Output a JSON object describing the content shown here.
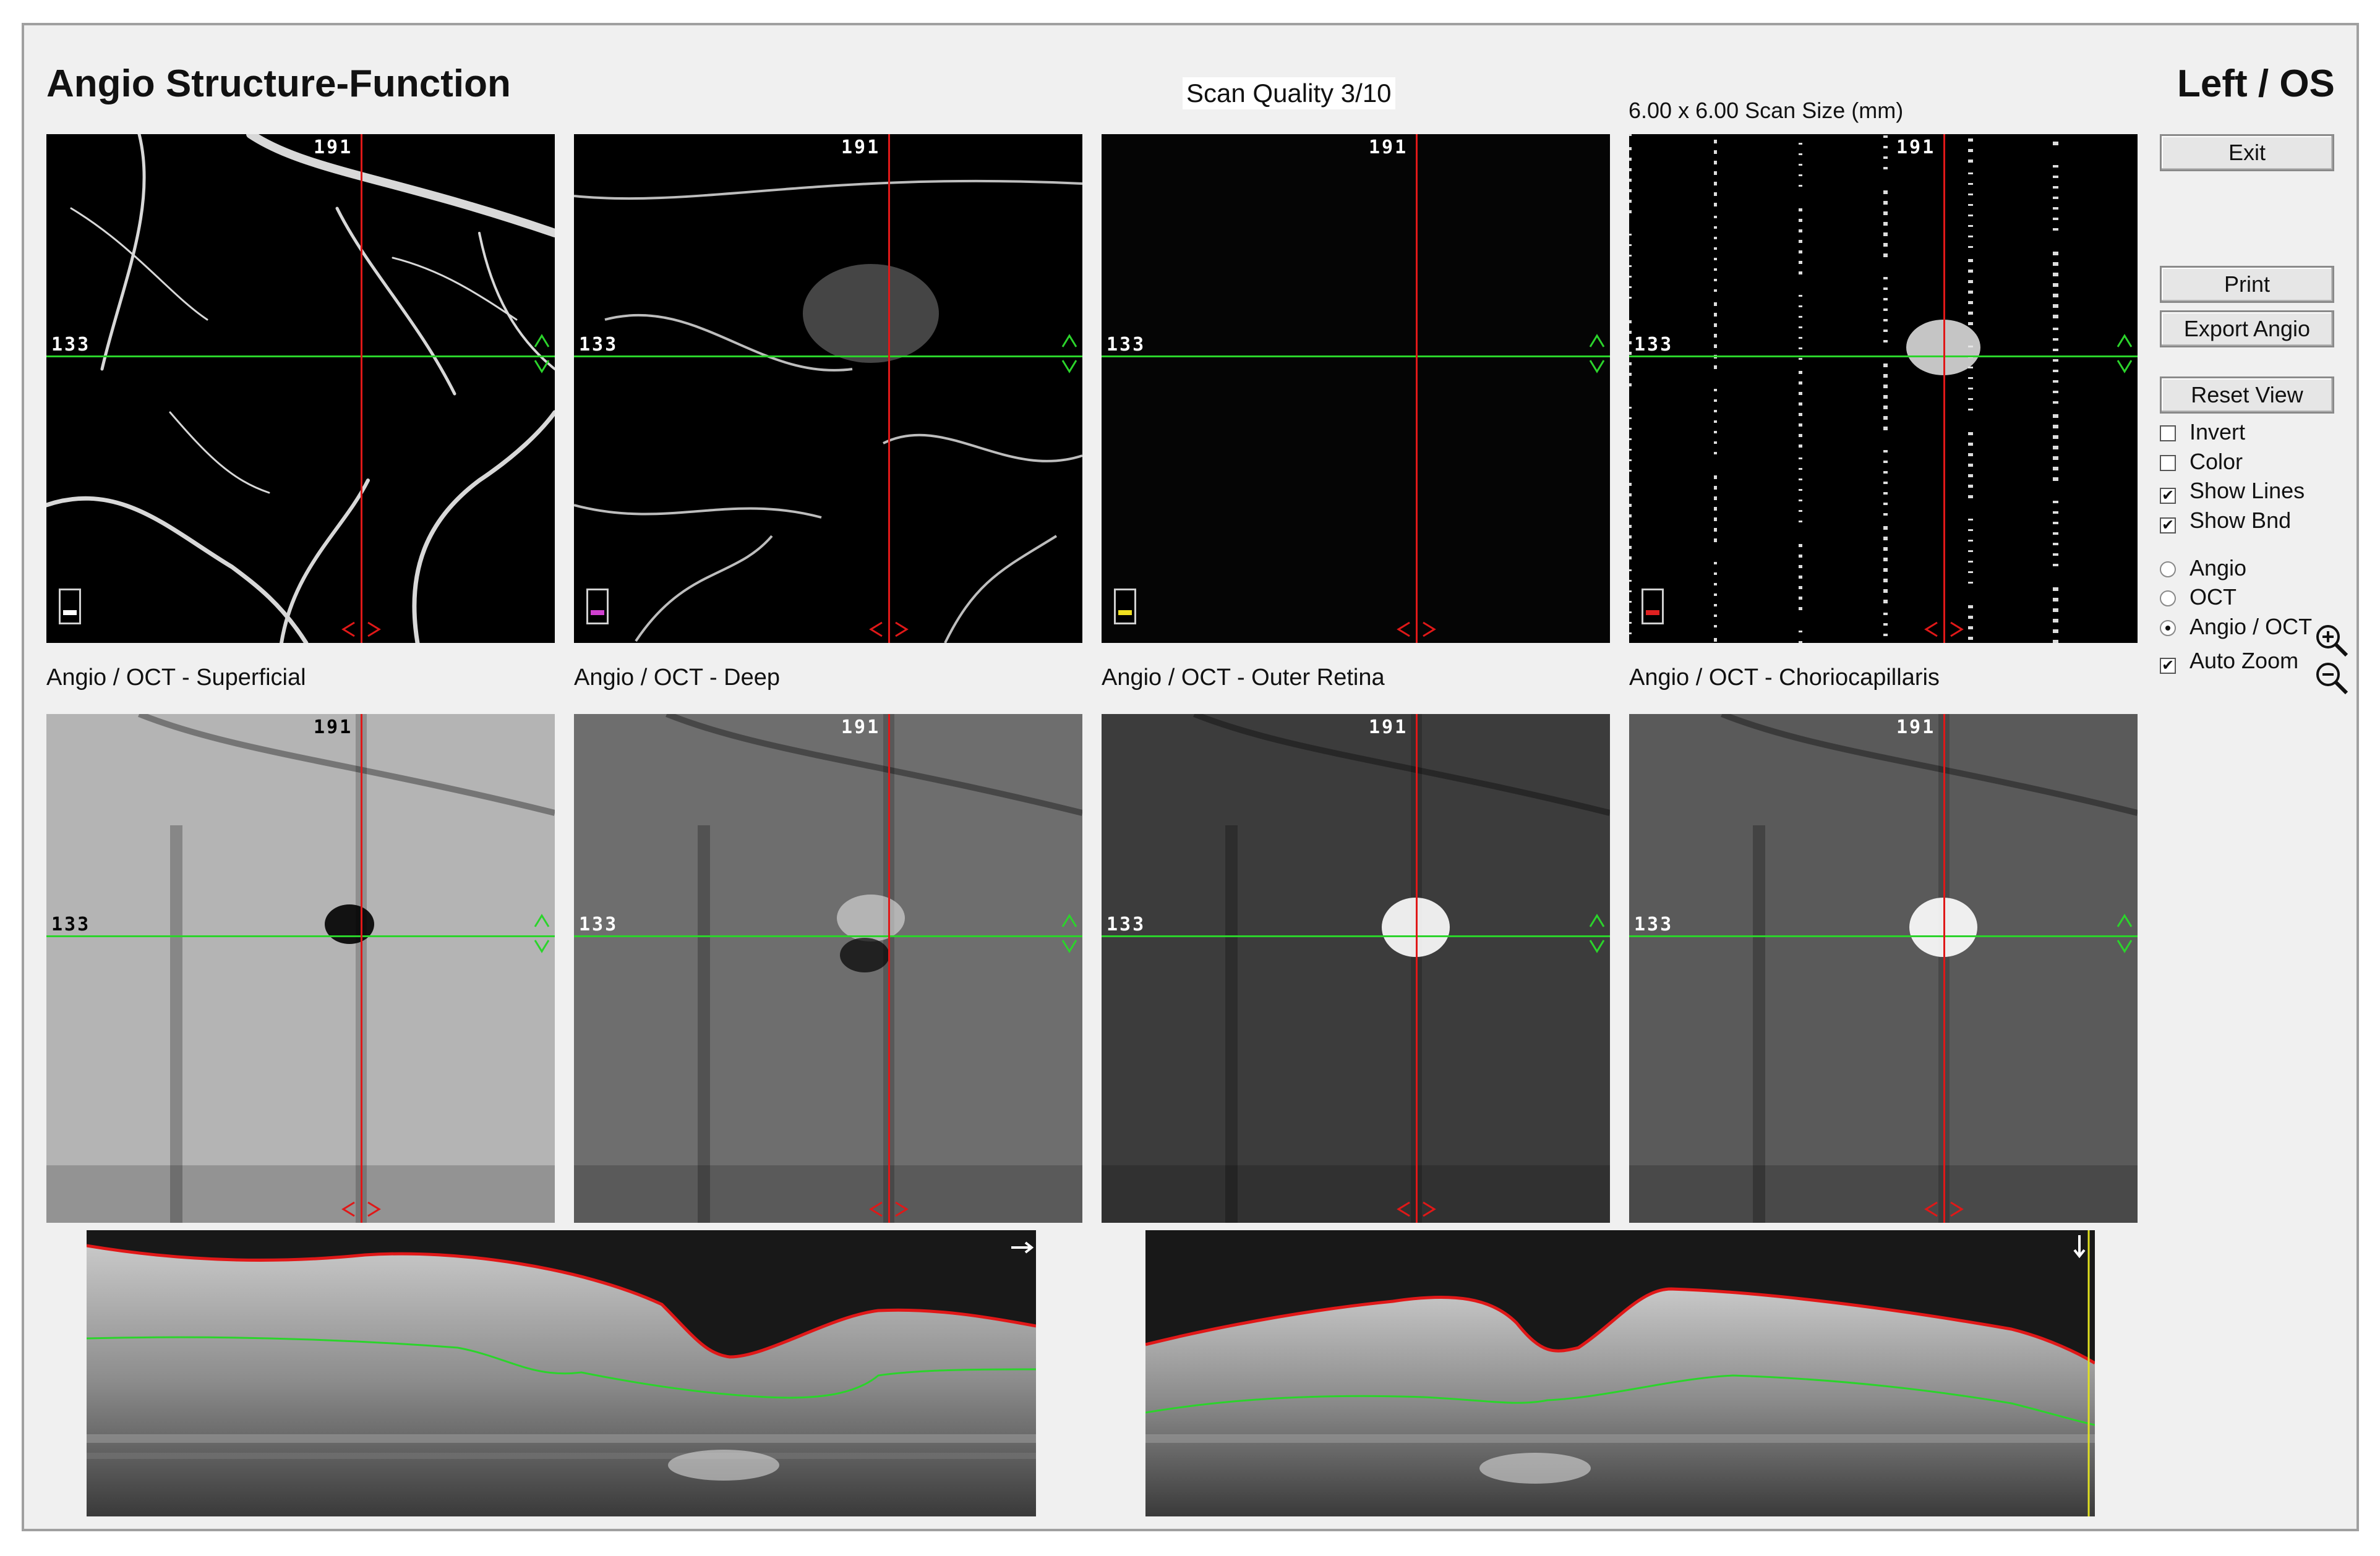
{
  "app": {
    "title": "Angio Structure-Function",
    "eye": "Left / OS"
  },
  "header": {
    "scan_quality": "Scan Quality 3/10",
    "scan_size": "6.00 x 6.00 Scan Size (mm)"
  },
  "crosshair": {
    "row": "133",
    "col": "191"
  },
  "panels_top": [
    {
      "id": "superficial",
      "swatch_color": "#ffffff"
    },
    {
      "id": "deep",
      "swatch_color": "#d040d0"
    },
    {
      "id": "outer-retina",
      "swatch_color": "#f0e020"
    },
    {
      "id": "choriocapillaris",
      "swatch_color": "#e02020"
    }
  ],
  "panel_labels": [
    "Angio / OCT - Superficial",
    "Angio / OCT - Deep",
    "Angio / OCT - Outer Retina",
    "Angio / OCT - Choriocapillaris"
  ],
  "buttons": {
    "exit": "Exit",
    "print": "Print",
    "export": "Export Angio",
    "reset": "Reset View"
  },
  "checkboxes": [
    {
      "label": "Invert",
      "checked": false
    },
    {
      "label": "Color",
      "checked": false
    },
    {
      "label": "Show Lines",
      "checked": true
    },
    {
      "label": "Show Bnd",
      "checked": true
    }
  ],
  "radios": [
    {
      "label": "Angio",
      "selected": false
    },
    {
      "label": "OCT",
      "selected": false
    },
    {
      "label": "Angio / OCT",
      "selected": true
    }
  ],
  "auto_zoom": {
    "label": "Auto Zoom",
    "checked": true
  },
  "icons": {
    "zoom_in": "zoom-in-icon",
    "zoom_out": "zoom-out-icon"
  },
  "colors": {
    "crosshair_h": "#2bd42b",
    "crosshair_v": "#e01818",
    "selected_border": "#66e6ee",
    "ilm_line": "#e01818",
    "rpe_line": "#2bd42b"
  }
}
